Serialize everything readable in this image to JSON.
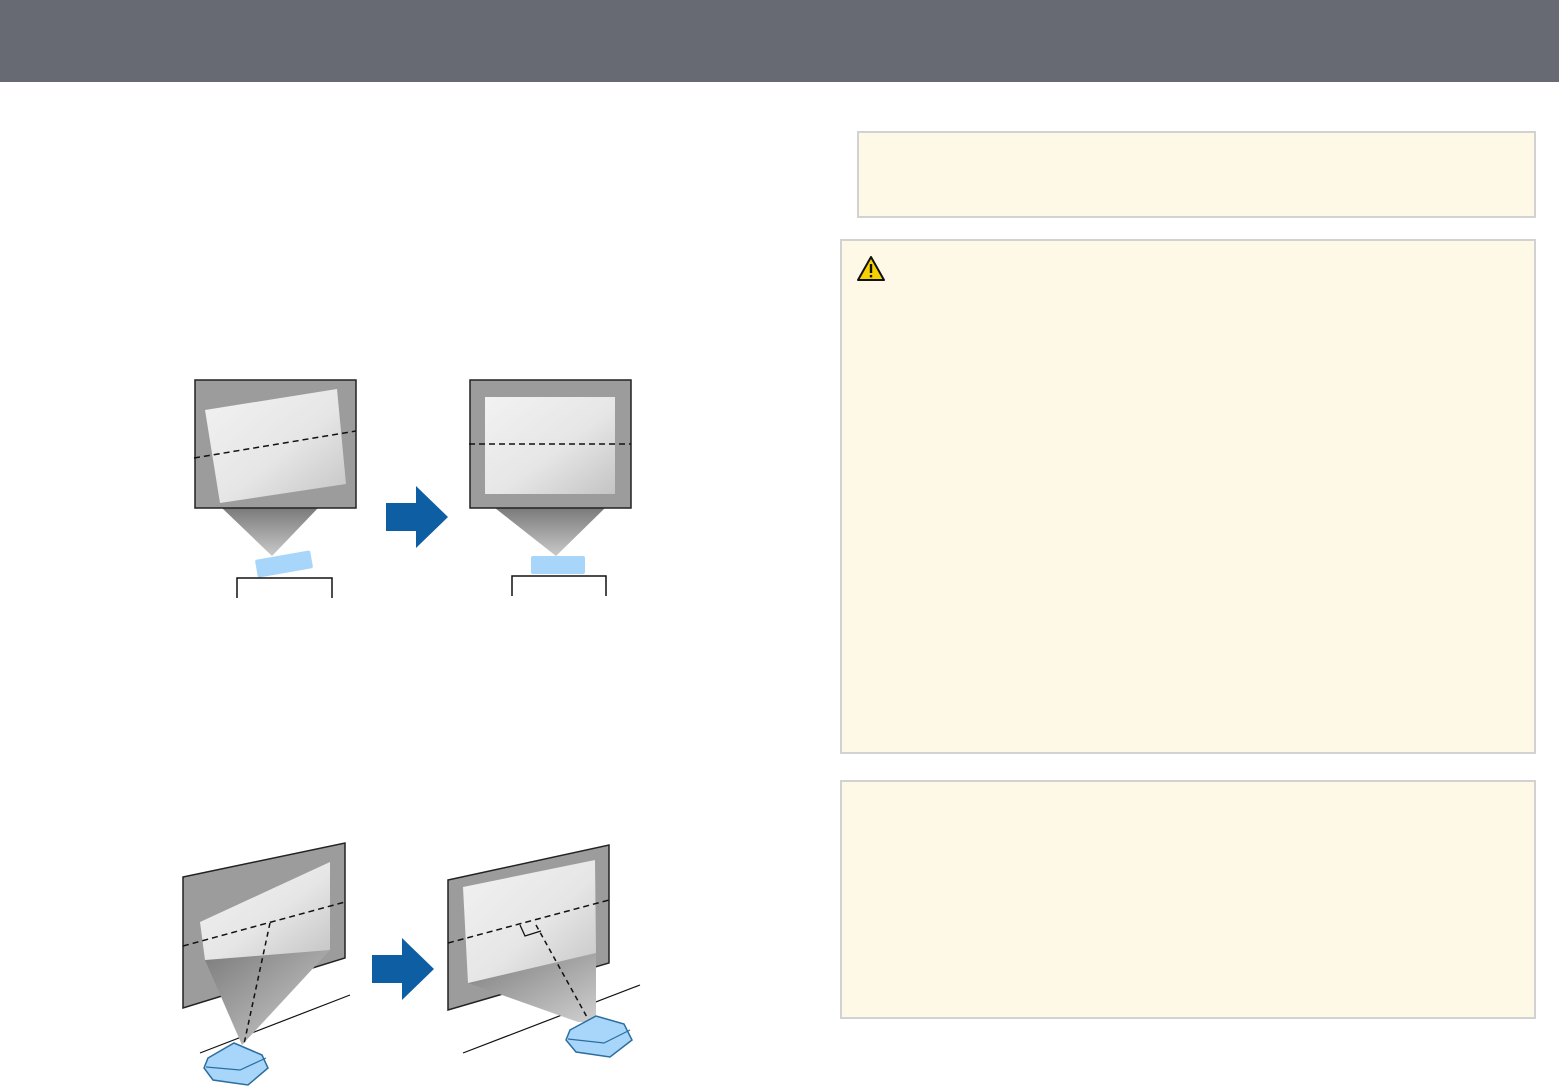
{
  "header": {
    "title": "",
    "color": "#676a72"
  },
  "notes": {
    "background": "#fef8e7",
    "border": "#d2d2d2",
    "warning_icon": "warning-triangle-icon"
  },
  "figures": {
    "level_adjust": {
      "description_shown": "",
      "arrow_color": "#0e5ea4",
      "projector_color": "#a8d6fa"
    },
    "perpendicular_placement": {
      "arrow_color": "#0e5ea4",
      "projector_color": "#a8d6fa"
    }
  }
}
